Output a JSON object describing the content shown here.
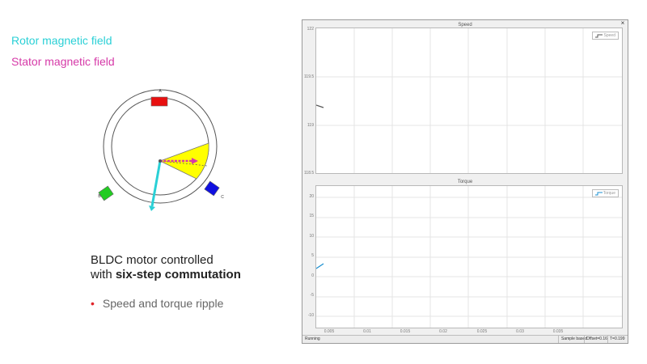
{
  "legend": {
    "rotor_label": "Rotor magnetic field",
    "stator_label": "Stator magnetic field",
    "rotor_color": "#2ad0d6",
    "stator_color": "#d63aa8"
  },
  "motor": {
    "pole_labels": [
      "A",
      "B",
      "C"
    ],
    "pole_colors": [
      "#e81010",
      "#22cc22",
      "#1010e0"
    ],
    "sector_color": "#ffff00"
  },
  "caption": {
    "line1": "BLDC motor controlled",
    "line2_prefix": "with ",
    "line2_bold": "six-step commutation",
    "bullet": "Speed and torque ripple"
  },
  "scope": {
    "close": "×",
    "panels": [
      {
        "title": "Speed",
        "legend_label": "Speed",
        "y_ticks": [
          "122",
          "119.5",
          "119",
          "118.5"
        ],
        "series_color": "#555555"
      },
      {
        "title": "Torque",
        "legend_label": "Torque",
        "y_ticks": [
          "20",
          "15",
          "10",
          "5",
          "0",
          "-5",
          "-10",
          "-15",
          "-20",
          "-25"
        ],
        "x_ticks": [
          "0",
          "0.005",
          "0.01",
          "0.015",
          "0.02",
          "0.025",
          "0.03",
          "0.035"
        ],
        "series_color": "#1a8fd0"
      }
    ],
    "status": {
      "state": "Running",
      "mode": "Sample based",
      "offset": "Offset=0.16",
      "time": "T=0.199"
    }
  }
}
